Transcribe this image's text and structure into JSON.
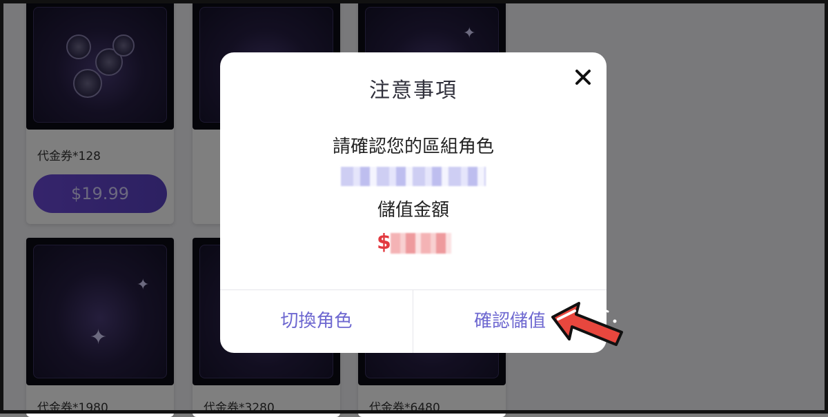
{
  "products": [
    {
      "title": "代金券*128",
      "price": "$19.99"
    },
    {
      "title": "代金券*1980"
    },
    {
      "title": "代金券*3280"
    },
    {
      "title": "代金券*6480"
    }
  ],
  "dialog": {
    "title": "注意事項",
    "confirm_role_text": "請確認您的區組角色",
    "amount_label": "儲值金額",
    "amount_currency": "$",
    "switch_role_button": "切換角色",
    "confirm_button": "確認儲值"
  },
  "colors": {
    "accent": "#6d67d0",
    "amount": "#e2393f",
    "price_button": "#5a42c4",
    "arrow": "#e8473e"
  },
  "icons": {
    "close": "close-icon",
    "pointer": "red-arrow-icon"
  }
}
